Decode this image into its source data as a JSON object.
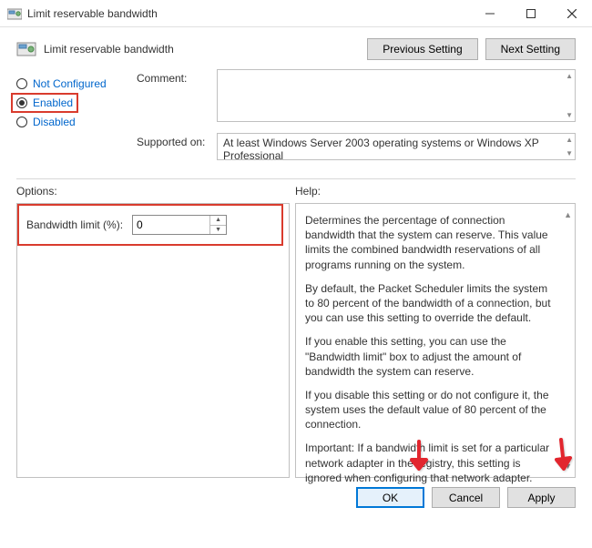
{
  "window": {
    "title": "Limit reservable bandwidth"
  },
  "header": {
    "title": "Limit reservable bandwidth"
  },
  "nav": {
    "previous": "Previous Setting",
    "next": "Next Setting"
  },
  "state": {
    "not_configured_label": "Not Configured",
    "enabled_label": "Enabled",
    "disabled_label": "Disabled",
    "selected": "enabled"
  },
  "fields": {
    "comment_label": "Comment:",
    "comment_value": "",
    "supported_label": "Supported on:",
    "supported_value": "At least Windows Server 2003 operating systems or Windows XP Professional"
  },
  "sections": {
    "options_label": "Options:",
    "help_label": "Help:"
  },
  "options": {
    "bandwidth_label": "Bandwidth limit (%):",
    "bandwidth_value": "0"
  },
  "help": {
    "p1": "Determines the percentage of connection bandwidth that the system can reserve. This value limits the combined bandwidth reservations of all programs running on the system.",
    "p2": "By default, the Packet Scheduler limits the system to 80 percent of the bandwidth of a connection, but you can use this setting to override the default.",
    "p3": "If you enable this setting, you can use the \"Bandwidth limit\" box to adjust the amount of bandwidth the system can reserve.",
    "p4": "If you disable this setting or do not configure it, the system uses the default value of 80 percent of the connection.",
    "p5": "Important: If a bandwidth limit is set for a particular network adapter in the registry, this setting is ignored when configuring that network adapter."
  },
  "buttons": {
    "ok": "OK",
    "cancel": "Cancel",
    "apply": "Apply"
  }
}
